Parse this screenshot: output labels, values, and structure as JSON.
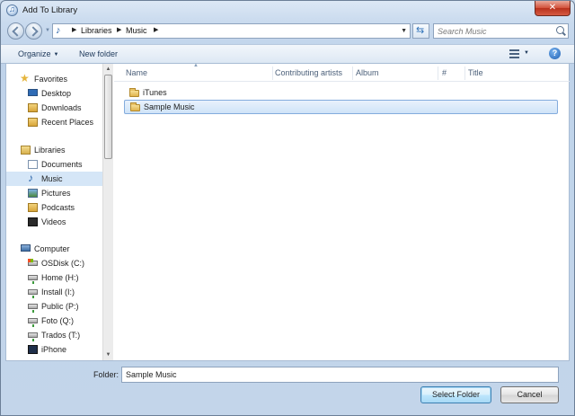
{
  "window": {
    "title": "Add To Library",
    "close_glyph": "✕"
  },
  "address": {
    "crumbs": [
      "Libraries",
      "Music"
    ],
    "search_placeholder": "Search Music"
  },
  "toolbar": {
    "organize_label": "Organize",
    "new_folder_label": "New folder",
    "help_glyph": "?"
  },
  "nav": {
    "favorites_header": "Favorites",
    "favorites": [
      "Desktop",
      "Downloads",
      "Recent Places"
    ],
    "libraries_header": "Libraries",
    "libraries": [
      "Documents",
      "Music",
      "Pictures",
      "Podcasts",
      "Videos"
    ],
    "selected": "Music",
    "computer_header": "Computer",
    "drives": [
      "OSDisk (C:)",
      "Home (H:)",
      "Install (I:)",
      "Public (P:)",
      "Foto (Q:)",
      "Trados (T:)",
      "iPhone"
    ]
  },
  "columns": [
    "Name",
    "Contributing artists",
    "Album",
    "#",
    "Title"
  ],
  "files": [
    {
      "name": "iTunes",
      "selected": false
    },
    {
      "name": "Sample Music",
      "selected": true
    }
  ],
  "bottom": {
    "folder_label": "Folder:",
    "folder_value": "Sample Music",
    "select_button": "Select Folder",
    "cancel_button": "Cancel"
  }
}
